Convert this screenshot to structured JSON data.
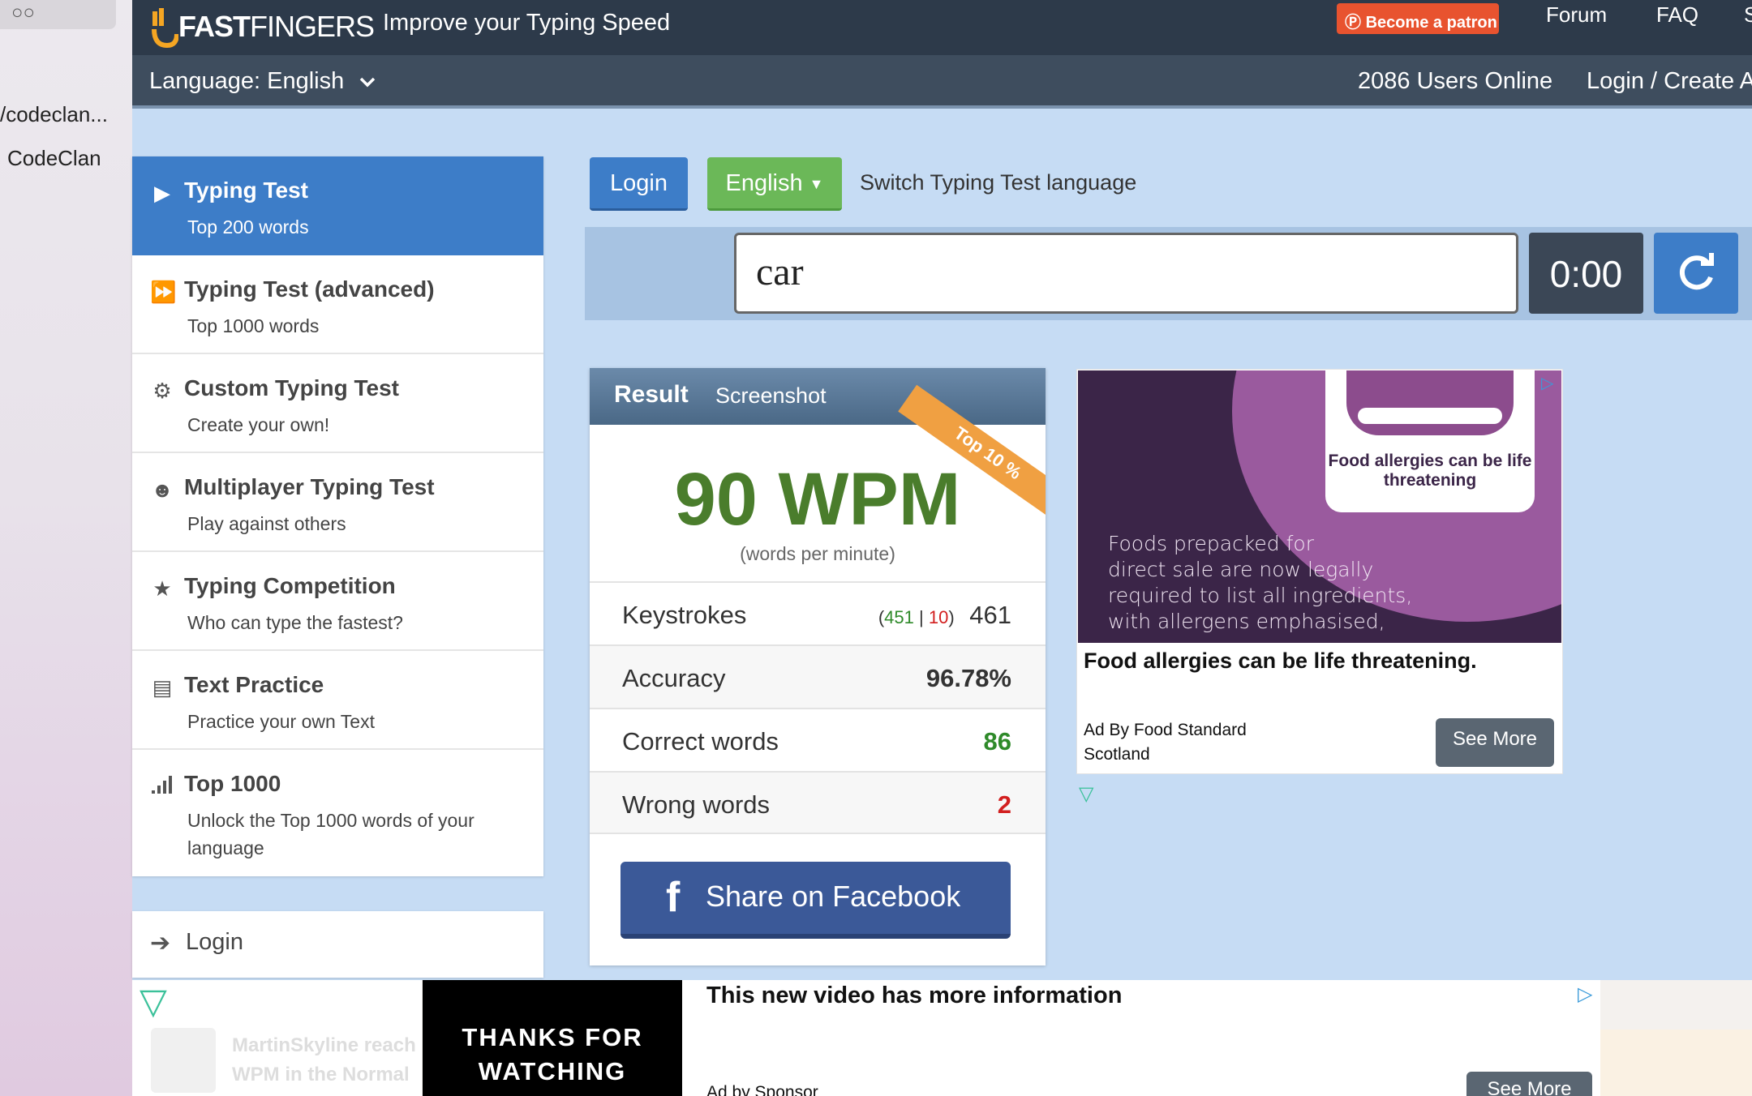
{
  "browser_sidebar": {
    "items": [
      "/codeclan...",
      "CodeClan"
    ]
  },
  "header": {
    "logo_text_bold": "FAST",
    "logo_text_light": "FINGERS",
    "tagline": "Improve your Typing Speed",
    "patron_label": "Become a patron",
    "forum": "Forum",
    "faq": "FAQ",
    "extra": "S",
    "language": "Language: English",
    "users_online": "2086 Users Online",
    "login_create": "Login / Create A"
  },
  "sidebar": {
    "items": [
      {
        "title": "Typing Test",
        "subtitle": "Top 200 words",
        "icon": "play-icon"
      },
      {
        "title": "Typing Test (advanced)",
        "subtitle": "Top 1000 words",
        "icon": "fast-forward-icon"
      },
      {
        "title": "Custom Typing Test",
        "subtitle": "Create your own!",
        "icon": "gears-icon"
      },
      {
        "title": "Multiplayer Typing Test",
        "subtitle": "Play against others",
        "icon": "users-icon"
      },
      {
        "title": "Typing Competition",
        "subtitle": "Who can type the fastest?",
        "icon": "trophy-icon"
      },
      {
        "title": "Text Practice",
        "subtitle": "Practice your own Text",
        "icon": "document-icon"
      },
      {
        "title": "Top 1000",
        "subtitle": "Unlock the Top 1000 words of your language",
        "icon": "signal-bars-icon"
      }
    ],
    "login": "Login"
  },
  "controls": {
    "login_button": "Login",
    "language_button": "English",
    "switch_label": "Switch Typing Test language",
    "word_input": "car",
    "timer": "0:00"
  },
  "result": {
    "tab_result": "Result",
    "tab_screenshot": "Screenshot",
    "ribbon": "Top 10 %",
    "wpm": "90 WPM",
    "wpm_sub": "(words per minute)",
    "keystrokes_label": "Keystrokes",
    "keystrokes_correct": "451",
    "keystrokes_wrong": "10",
    "keystrokes_total": "461",
    "accuracy_label": "Accuracy",
    "accuracy_value": "96.78%",
    "correct_label": "Correct words",
    "correct_value": "86",
    "wrong_label": "Wrong words",
    "wrong_value": "2",
    "share_facebook": "Share on Facebook"
  },
  "ad_right": {
    "box_text": "Food allergies can be life threatening",
    "image_text_lines": [
      "Foods prepacked for",
      "direct sale are now legally",
      "required to list all ingredients,",
      "with allergens emphasised,"
    ],
    "title": "Food allergies can be life threatening.",
    "by_line1": "Ad By Food Standard",
    "by_line2": "Scotland",
    "see_more": "See More"
  },
  "ad_bottom": {
    "ghost_text_1": "MartinSkyline reach",
    "ghost_text_2": "WPM in the Normal",
    "thanks": "THANKS FOR WATCHING",
    "title": "This new video has more information",
    "by": "Ad by Sponsor",
    "see_more": "See More"
  },
  "colors": {
    "topbar": "#2d3a4a",
    "navbar": "#3e4d5e",
    "active_blue": "#3d7dc8",
    "green_button": "#6bb858",
    "wpm_green": "#4a7d2c",
    "facebook": "#3b5998",
    "patron": "#e8532f"
  }
}
